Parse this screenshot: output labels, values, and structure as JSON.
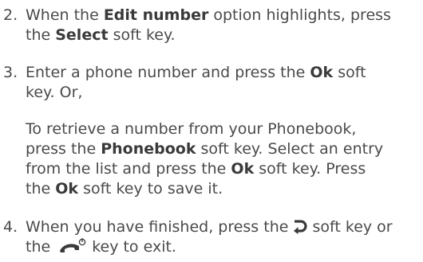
{
  "steps": [
    {
      "number": "2.",
      "l1_a": "When the ",
      "l1_b": "Edit number",
      "l1_c": " option highlights, press",
      "l2_a": "the ",
      "l2_b": "Select",
      "l2_c": " soft key."
    },
    {
      "number": "3.",
      "l1_a": "Enter a phone number and press the ",
      "l1_b": "Ok",
      "l1_c": " soft",
      "l2_a": "key. Or,",
      "p2_l1": "To retrieve a number from your Phonebook,",
      "p2_l2_a": "press the ",
      "p2_l2_b": "Phonebook",
      "p2_l2_c": " soft key. Select an entry",
      "p2_l3_a": "from the list and press the ",
      "p2_l3_b": "Ok",
      "p2_l3_c": " soft key. Press",
      "p2_l4_a": "the ",
      "p2_l4_b": "Ok",
      "p2_l4_c": " soft key to save it."
    },
    {
      "number": "4.",
      "l1_a": "When you have finished, press the ",
      "l1_c": " soft key or",
      "l2_a": "the",
      "l2_c": "key to exit.",
      "back_icon": "back-arrow-icon",
      "end_icon": "end-power-key-icon"
    }
  ],
  "colors": {
    "text": "#4a4a4a",
    "bold_text": "#3a3a3a"
  }
}
